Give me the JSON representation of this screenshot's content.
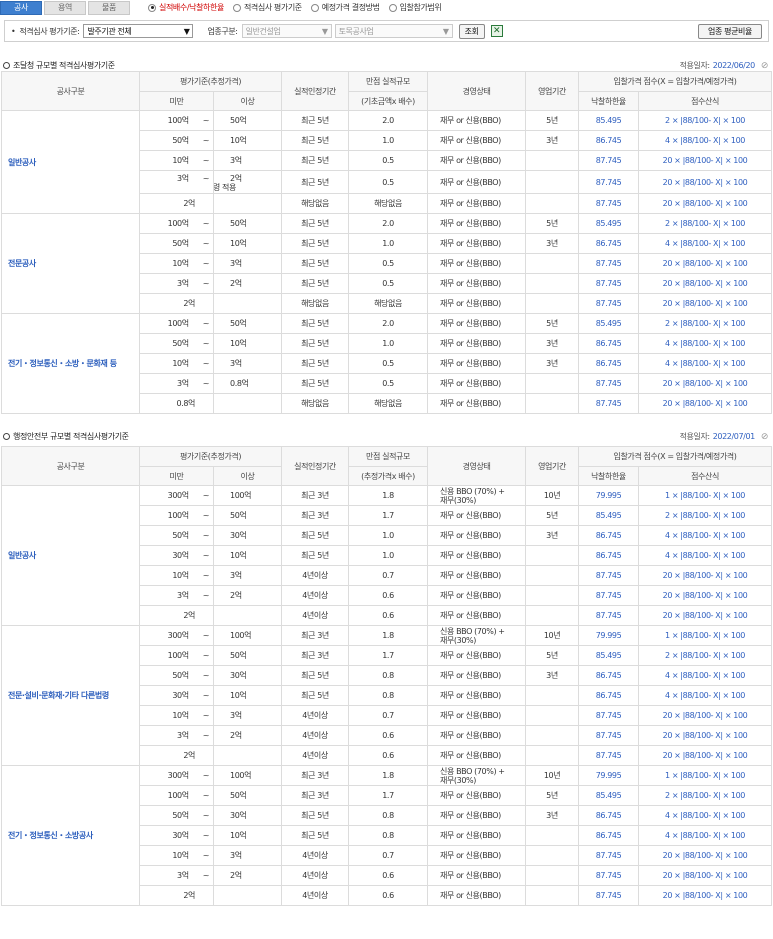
{
  "tabs": [
    "공사",
    "용역",
    "물품"
  ],
  "radios": [
    "실적배수/낙찰하한율",
    "적격심사 평가기준",
    "예정가격 결정방법",
    "입찰참가범위"
  ],
  "filter": {
    "label": "적격심사 평가기준:",
    "agency": "발주기관 전체",
    "category_label": "업종구분:",
    "category": "일반건설업",
    "subcategory": "토목공사업",
    "search_btn": "조회",
    "avg_btn": "업종 평균비율"
  },
  "icons": {
    "excel": "excel-icon",
    "clip": "paperclip-icon"
  },
  "sections": [
    {
      "title": "조달청 규모별 적격심사평가기준",
      "date_label": "적용일자:",
      "date": "2022/06/20",
      "head": {
        "c1": "공사구분",
        "c2": "평가기준(추정가격)",
        "c2a": "미만",
        "c2b": "이상",
        "c3": "실적인정기간",
        "c4": "만점 실적규모",
        "c4b": "(기초금액x 배수)",
        "c5": "경영상태",
        "c6": "영업기간",
        "c7": "입찰가격 점수(X = 입찰가격/예정가격)",
        "c7a": "낙찰하한율",
        "c7b": "점수산식"
      },
      "groups": [
        {
          "name": "일반공사",
          "rows": [
            {
              "lt": "100억",
              "sep": "~",
              "ge": "50억",
              "note": "",
              "period": "최근 5년",
              "scale": "2.0",
              "mgmt": "재무 or 신용(BBO)",
              "biz": "5년",
              "rate": "85.495",
              "formula": "2 × |88/100- X| × 100"
            },
            {
              "lt": "50억",
              "sep": "~",
              "ge": "10억",
              "note": "",
              "period": "최근 5년",
              "scale": "1.0",
              "mgmt": "재무 or 신용(BBO)",
              "biz": "3년",
              "rate": "86.745",
              "formula": "4 × |88/100- X| × 100"
            },
            {
              "lt": "10억",
              "sep": "~",
              "ge": "3억",
              "note": "",
              "period": "최근 5년",
              "scale": "0.5",
              "mgmt": "재무 or 신용(BBO)",
              "biz": "",
              "rate": "87.745",
              "formula": "20 × |88/100- X| × 100"
            },
            {
              "lt": "3억",
              "sep": "~",
              "ge": "2억",
              "note": "동일법령 적용",
              "period": "최근 5년",
              "scale": "0.5",
              "mgmt": "재무 or 신용(BBO)",
              "biz": "",
              "rate": "87.745",
              "formula": "20 × |88/100- X| × 100"
            },
            {
              "lt": "2억",
              "sep": "",
              "ge": "",
              "note": "",
              "period": "해당없음",
              "scale": "해당없음",
              "mgmt": "재무 or 신용(BBO)",
              "biz": "",
              "rate": "87.745",
              "formula": "20 × |88/100- X| × 100"
            }
          ]
        },
        {
          "name": "전문공사",
          "rows": [
            {
              "lt": "100억",
              "sep": "~",
              "ge": "50억",
              "note": "",
              "period": "최근 5년",
              "scale": "2.0",
              "mgmt": "재무 or 신용(BBO)",
              "biz": "5년",
              "rate": "85.495",
              "formula": "2 × |88/100- X| × 100"
            },
            {
              "lt": "50억",
              "sep": "~",
              "ge": "10억",
              "note": "",
              "period": "최근 5년",
              "scale": "1.0",
              "mgmt": "재무 or 신용(BBO)",
              "biz": "3년",
              "rate": "86.745",
              "formula": "4 × |88/100- X| × 100"
            },
            {
              "lt": "10억",
              "sep": "~",
              "ge": "3억",
              "note": "",
              "period": "최근 5년",
              "scale": "0.5",
              "mgmt": "재무 or 신용(BBO)",
              "biz": "",
              "rate": "87.745",
              "formula": "20 × |88/100- X| × 100"
            },
            {
              "lt": "3억",
              "sep": "~",
              "ge": "2억",
              "note": "",
              "period": "최근 5년",
              "scale": "0.5",
              "mgmt": "재무 or 신용(BBO)",
              "biz": "",
              "rate": "87.745",
              "formula": "20 × |88/100- X| × 100"
            },
            {
              "lt": "2억",
              "sep": "",
              "ge": "",
              "note": "",
              "period": "해당없음",
              "scale": "해당없음",
              "mgmt": "재무 or 신용(BBO)",
              "biz": "",
              "rate": "87.745",
              "formula": "20 × |88/100- X| × 100"
            }
          ]
        },
        {
          "name": "전기・정보통신・소방・문화재 등",
          "rows": [
            {
              "lt": "100억",
              "sep": "~",
              "ge": "50억",
              "note": "",
              "period": "최근 5년",
              "scale": "2.0",
              "mgmt": "재무 or 신용(BBO)",
              "biz": "5년",
              "rate": "85.495",
              "formula": "2 × |88/100- X| × 100"
            },
            {
              "lt": "50억",
              "sep": "~",
              "ge": "10억",
              "note": "",
              "period": "최근 5년",
              "scale": "1.0",
              "mgmt": "재무 or 신용(BBO)",
              "biz": "3년",
              "rate": "86.745",
              "formula": "4 × |88/100- X| × 100"
            },
            {
              "lt": "10억",
              "sep": "~",
              "ge": "3억",
              "note": "",
              "period": "최근 5년",
              "scale": "0.5",
              "mgmt": "재무 or 신용(BBO)",
              "biz": "3년",
              "rate": "86.745",
              "formula": "4 × |88/100- X| × 100"
            },
            {
              "lt": "3억",
              "sep": "~",
              "ge": "0.8억",
              "note": "",
              "period": "최근 5년",
              "scale": "0.5",
              "mgmt": "재무 or 신용(BBO)",
              "biz": "",
              "rate": "87.745",
              "formula": "20 × |88/100- X| × 100"
            },
            {
              "lt": "0.8억",
              "sep": "",
              "ge": "",
              "note": "",
              "period": "해당없음",
              "scale": "해당없음",
              "mgmt": "재무 or 신용(BBO)",
              "biz": "",
              "rate": "87.745",
              "formula": "20 × |88/100- X| × 100"
            }
          ]
        }
      ]
    },
    {
      "title": "행정안전부 규모별 적격심사평가기준",
      "date_label": "적용일자:",
      "date": "2022/07/01",
      "head": {
        "c1": "공사구분",
        "c2": "평가기준(추정가격)",
        "c2a": "미만",
        "c2b": "이상",
        "c3": "실적인정기간",
        "c4": "만점 실적규모",
        "c4b": "(추정가격x 배수)",
        "c5": "경영상태",
        "c6": "영업기간",
        "c7": "입찰가격 점수(X = 입찰가격/예정가격)",
        "c7a": "낙찰하한율",
        "c7b": "점수산식"
      },
      "groups": [
        {
          "name": "일반공사",
          "rows": [
            {
              "lt": "300억",
              "sep": "~",
              "ge": "100억",
              "period": "최근 3년",
              "scale": "1.8",
              "mgmt": "신용 BBO (70%) +",
              "mgmt2": "재무(30%)",
              "biz": "10년",
              "rate": "79.995",
              "formula": "1 × |88/100- X| × 100"
            },
            {
              "lt": "100억",
              "sep": "~",
              "ge": "50억",
              "period": "최근 3년",
              "scale": "1.7",
              "mgmt": "재무 or 신용(BBO)",
              "mgmt2": "",
              "biz": "5년",
              "rate": "85.495",
              "formula": "2 × |88/100- X| × 100"
            },
            {
              "lt": "50억",
              "sep": "~",
              "ge": "30억",
              "period": "최근 5년",
              "scale": "1.0",
              "mgmt": "재무 or 신용(BBO)",
              "mgmt2": "",
              "biz": "3년",
              "rate": "86.745",
              "formula": "4 × |88/100- X| × 100"
            },
            {
              "lt": "30억",
              "sep": "~",
              "ge": "10억",
              "period": "최근 5년",
              "scale": "1.0",
              "mgmt": "재무 or 신용(BBO)",
              "mgmt2": "",
              "biz": "",
              "rate": "86.745",
              "formula": "4 × |88/100- X| × 100"
            },
            {
              "lt": "10억",
              "sep": "~",
              "ge": "3억",
              "period": "4년이상",
              "scale": "0.7",
              "mgmt": "재무 or 신용(BBO)",
              "mgmt2": "",
              "biz": "",
              "rate": "87.745",
              "formula": "20 × |88/100- X| × 100"
            },
            {
              "lt": "3억",
              "sep": "~",
              "ge": "2억",
              "period": "4년이상",
              "scale": "0.6",
              "mgmt": "재무 or 신용(BBO)",
              "mgmt2": "",
              "biz": "",
              "rate": "87.745",
              "formula": "20 × |88/100- X| × 100"
            },
            {
              "lt": "2억",
              "sep": "",
              "ge": "",
              "period": "4년이상",
              "scale": "0.6",
              "mgmt": "재무 or 신용(BBO)",
              "mgmt2": "",
              "biz": "",
              "rate": "87.745",
              "formula": "20 × |88/100- X| × 100"
            }
          ]
        },
        {
          "name": "전문·설비·문화재·기타 다른법령",
          "rows": [
            {
              "lt": "300억",
              "sep": "~",
              "ge": "100억",
              "period": "최근 3년",
              "scale": "1.8",
              "mgmt": "신용 BBO (70%) +",
              "mgmt2": "재무(30%)",
              "biz": "10년",
              "rate": "79.995",
              "formula": "1 × |88/100- X| × 100"
            },
            {
              "lt": "100억",
              "sep": "~",
              "ge": "50억",
              "period": "최근 3년",
              "scale": "1.7",
              "mgmt": "재무 or 신용(BBO)",
              "mgmt2": "",
              "biz": "5년",
              "rate": "85.495",
              "formula": "2 × |88/100- X| × 100"
            },
            {
              "lt": "50억",
              "sep": "~",
              "ge": "30억",
              "period": "최근 5년",
              "scale": "0.8",
              "mgmt": "재무 or 신용(BBO)",
              "mgmt2": "",
              "biz": "3년",
              "rate": "86.745",
              "formula": "4 × |88/100- X| × 100"
            },
            {
              "lt": "30억",
              "sep": "~",
              "ge": "10억",
              "period": "최근 5년",
              "scale": "0.8",
              "mgmt": "재무 or 신용(BBO)",
              "mgmt2": "",
              "biz": "",
              "rate": "86.745",
              "formula": "4 × |88/100- X| × 100"
            },
            {
              "lt": "10억",
              "sep": "~",
              "ge": "3억",
              "period": "4년이상",
              "scale": "0.7",
              "mgmt": "재무 or 신용(BBO)",
              "mgmt2": "",
              "biz": "",
              "rate": "87.745",
              "formula": "20 × |88/100- X| × 100"
            },
            {
              "lt": "3억",
              "sep": "~",
              "ge": "2억",
              "period": "4년이상",
              "scale": "0.6",
              "mgmt": "재무 or 신용(BBO)",
              "mgmt2": "",
              "biz": "",
              "rate": "87.745",
              "formula": "20 × |88/100- X| × 100"
            },
            {
              "lt": "2억",
              "sep": "",
              "ge": "",
              "period": "4년이상",
              "scale": "0.6",
              "mgmt": "재무 or 신용(BBO)",
              "mgmt2": "",
              "biz": "",
              "rate": "87.745",
              "formula": "20 × |88/100- X| × 100"
            }
          ]
        },
        {
          "name": "전기・정보통신・소방공사",
          "rows": [
            {
              "lt": "300억",
              "sep": "~",
              "ge": "100억",
              "period": "최근 3년",
              "scale": "1.8",
              "mgmt": "신용 BBO (70%) +",
              "mgmt2": "재무(30%)",
              "biz": "10년",
              "rate": "79.995",
              "formula": "1 × |88/100- X| × 100"
            },
            {
              "lt": "100억",
              "sep": "~",
              "ge": "50억",
              "period": "최근 3년",
              "scale": "1.7",
              "mgmt": "재무 or 신용(BBO)",
              "mgmt2": "",
              "biz": "5년",
              "rate": "85.495",
              "formula": "2 × |88/100- X| × 100"
            },
            {
              "lt": "50억",
              "sep": "~",
              "ge": "30억",
              "period": "최근 5년",
              "scale": "0.8",
              "mgmt": "재무 or 신용(BBO)",
              "mgmt2": "",
              "biz": "3년",
              "rate": "86.745",
              "formula": "4 × |88/100- X| × 100"
            },
            {
              "lt": "30억",
              "sep": "~",
              "ge": "10억",
              "period": "최근 5년",
              "scale": "0.8",
              "mgmt": "재무 or 신용(BBO)",
              "mgmt2": "",
              "biz": "",
              "rate": "86.745",
              "formula": "4 × |88/100- X| × 100"
            },
            {
              "lt": "10억",
              "sep": "~",
              "ge": "3억",
              "period": "4년이상",
              "scale": "0.7",
              "mgmt": "재무 or 신용(BBO)",
              "mgmt2": "",
              "biz": "",
              "rate": "87.745",
              "formula": "20 × |88/100- X| × 100"
            },
            {
              "lt": "3억",
              "sep": "~",
              "ge": "2억",
              "period": "4년이상",
              "scale": "0.6",
              "mgmt": "재무 or 신용(BBO)",
              "mgmt2": "",
              "biz": "",
              "rate": "87.745",
              "formula": "20 × |88/100- X| × 100"
            },
            {
              "lt": "2억",
              "sep": "",
              "ge": "",
              "period": "4년이상",
              "scale": "0.6",
              "mgmt": "재무 or 신용(BBO)",
              "mgmt2": "",
              "biz": "",
              "rate": "87.745",
              "formula": "20 × |88/100- X| × 100"
            }
          ]
        }
      ]
    }
  ]
}
